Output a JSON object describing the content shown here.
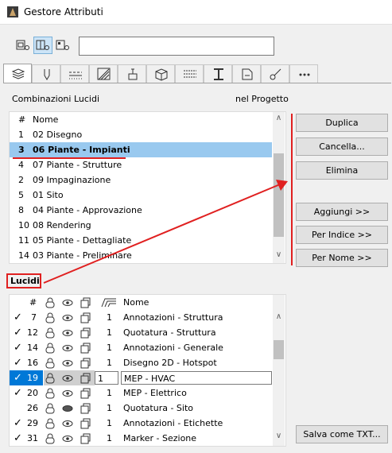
{
  "window": {
    "title": "Gestore Attributi"
  },
  "toolbar": {
    "view_buttons": [
      {
        "icon": "list-view-icon",
        "active": false
      },
      {
        "icon": "split-view-icon",
        "active": true
      },
      {
        "icon": "detail-view-icon",
        "active": false
      }
    ],
    "search_value": ""
  },
  "tabs": [
    {
      "icon": "layers-icon",
      "active": true
    },
    {
      "icon": "pen-icon",
      "active": false
    },
    {
      "icon": "line-types-icon",
      "active": false
    },
    {
      "icon": "fill-icon",
      "active": false
    },
    {
      "icon": "surface-icon",
      "active": false
    },
    {
      "icon": "composite-icon",
      "active": false
    },
    {
      "icon": "profile-icon",
      "active": false
    },
    {
      "icon": "beam-icon",
      "active": false
    },
    {
      "icon": "zone-icon",
      "active": false
    },
    {
      "icon": "mep-icon",
      "active": false
    },
    {
      "icon": "more-icon",
      "active": false
    }
  ],
  "combinations": {
    "label": "Combinazioni Lucidi",
    "project_label": "nel Progetto",
    "headers": {
      "num": "#",
      "name": "Nome"
    },
    "rows": [
      {
        "num": "1",
        "name": "02 Disegno",
        "selected": false
      },
      {
        "num": "3",
        "name": "06 Piante - Impianti",
        "selected": true
      },
      {
        "num": "4",
        "name": "07 Piante - Strutture",
        "selected": false
      },
      {
        "num": "2",
        "name": "09 Impaginazione",
        "selected": false
      },
      {
        "num": "5",
        "name": "01 Sito",
        "selected": false
      },
      {
        "num": "8",
        "name": "04 Piante - Approvazione",
        "selected": false
      },
      {
        "num": "10",
        "name": "08 Rendering",
        "selected": false
      },
      {
        "num": "11",
        "name": "05 Piante - Dettagliate",
        "selected": false
      },
      {
        "num": "14",
        "name": "03 Piante - Preliminare",
        "selected": false
      }
    ]
  },
  "buttons": {
    "duplica": "Duplica",
    "cancella": "Cancella...",
    "elimina": "Elimina",
    "aggiungi": "Aggiungi >>",
    "per_indice": "Per Indice >>",
    "per_nome": "Per Nome >>",
    "salva_txt": "Salva come TXT..."
  },
  "layers": {
    "label": "Lucidi",
    "headers": {
      "num": "#",
      "name": "Nome"
    },
    "rows": [
      {
        "checked": true,
        "num": "7",
        "visible": true,
        "pen": "1",
        "name": "Annotazioni - Struttura",
        "selected": false
      },
      {
        "checked": true,
        "num": "12",
        "visible": true,
        "pen": "1",
        "name": "Quotatura - Struttura",
        "selected": false
      },
      {
        "checked": true,
        "num": "14",
        "visible": true,
        "pen": "1",
        "name": "Annotazioni - Generale",
        "selected": false
      },
      {
        "checked": true,
        "num": "16",
        "visible": true,
        "pen": "1",
        "name": "Disegno 2D - Hotspot",
        "selected": false
      },
      {
        "checked": true,
        "num": "19",
        "visible": true,
        "pen": "1",
        "name": "MEP - HVAC",
        "selected": true
      },
      {
        "checked": true,
        "num": "20",
        "visible": true,
        "pen": "1",
        "name": "MEP - Elettrico",
        "selected": false
      },
      {
        "checked": false,
        "num": "26",
        "visible": false,
        "pen": "1",
        "name": "Quotatura - Sito",
        "selected": false
      },
      {
        "checked": true,
        "num": "29",
        "visible": true,
        "pen": "1",
        "name": "Annotazioni - Etichette",
        "selected": false
      },
      {
        "checked": true,
        "num": "31",
        "visible": true,
        "pen": "1",
        "name": "Marker - Sezione",
        "selected": false
      }
    ]
  },
  "colors": {
    "annotation": "#e02020",
    "selection": "#99c9ef",
    "accent": "#0078d7"
  }
}
